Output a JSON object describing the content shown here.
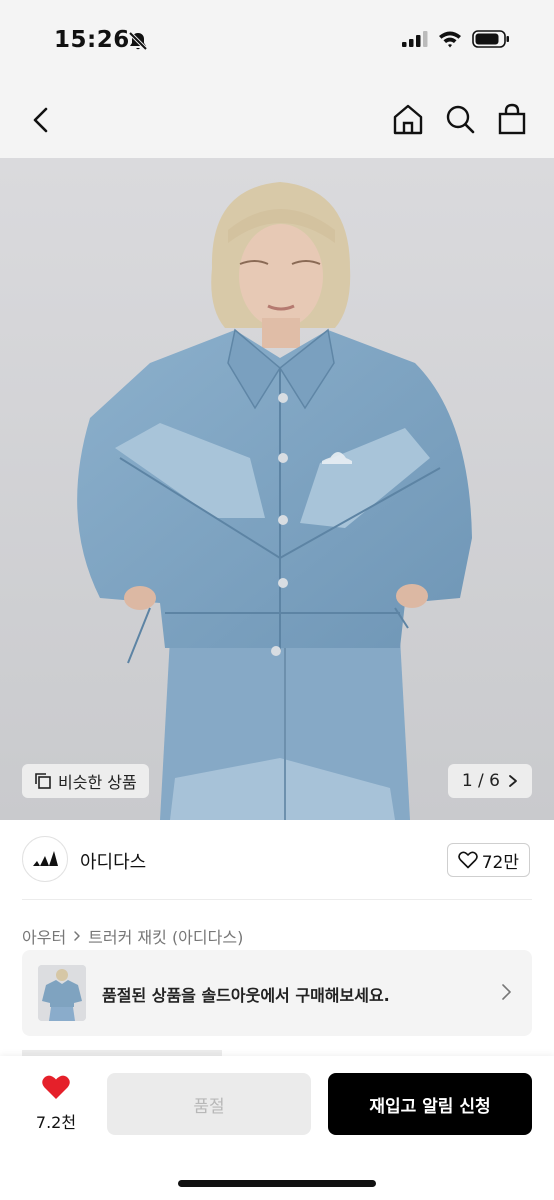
{
  "status_bar": {
    "time": "15:26"
  },
  "product": {
    "similar_label": "비슷한 상품",
    "page_counter": "1 / 6",
    "brand_name": "아디다스",
    "like_count": "72만",
    "breadcrumb": [
      "아우터",
      "트러커 재킷 (아디다스)"
    ],
    "promo_text": "품절된 상품을 솔드아웃에서 구매해보세요."
  },
  "bottom_bar": {
    "wish_count": "7.2천",
    "soldout_label": "품절",
    "restock_label": "재입고 알림 신청"
  },
  "colors": {
    "wish_heart": "#e5202a",
    "primary_button": "#000000",
    "denim": "#7fa3c0"
  }
}
